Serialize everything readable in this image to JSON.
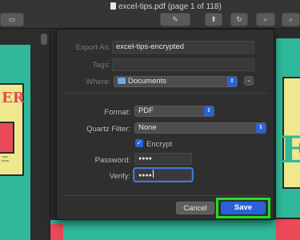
{
  "window": {
    "title": "excel-tips.pdf (page 1 of 118)",
    "edit_label": "✎",
    "share_label": "⬆"
  },
  "sidebar": {
    "thumb_heading": "ER",
    "thumb_lines": [
      "Tricks",
      "EXCEL"
    ]
  },
  "dialog": {
    "export_as_label": "Export As:",
    "export_as_value": "excel-tips-encrypted",
    "tags_label": "Tags:",
    "tags_value": "",
    "where_label": "Where:",
    "where_value": "Documents",
    "format_label": "Format:",
    "format_value": "PDF",
    "quartz_label": "Quartz Filter:",
    "quartz_value": "None",
    "encrypt_label": "Encrypt",
    "encrypt_checked": true,
    "password_label": "Password:",
    "password_value": "●●●●",
    "verify_label": "Verify:",
    "verify_value": "●●●●",
    "cancel_label": "Cancel",
    "save_label": "Save"
  },
  "document": {
    "right_text": "E"
  },
  "colors": {
    "accent": "#2b62d8",
    "highlight": "#1de01d",
    "page_green": "#2fb99a",
    "page_yellow": "#efe88e",
    "page_red": "#e84a57"
  }
}
